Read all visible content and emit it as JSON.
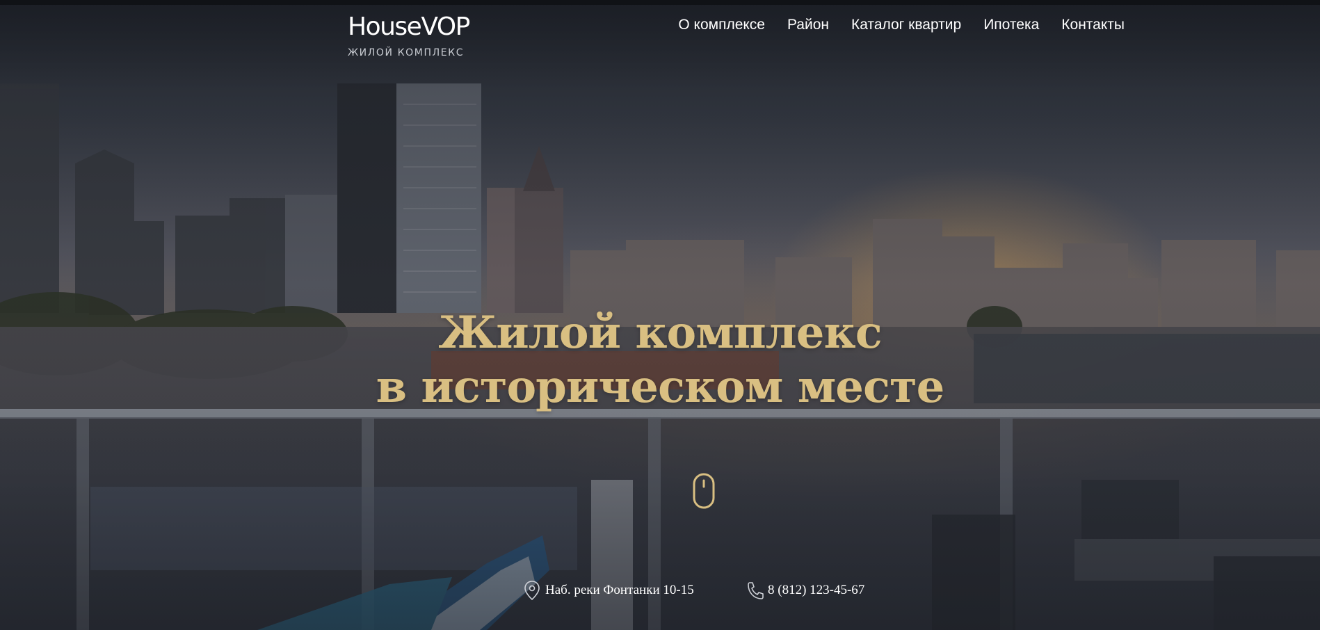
{
  "header": {
    "logo_title": "HouseVOP",
    "logo_subtitle": "ЖИЛОЙ КОМПЛЕКС",
    "nav": [
      {
        "label": "О комплексе"
      },
      {
        "label": "Район"
      },
      {
        "label": "Каталог квартир"
      },
      {
        "label": "Ипотека"
      },
      {
        "label": "Контакты"
      }
    ]
  },
  "hero": {
    "title_line1": "Жилой комплекс",
    "title_line2": "в историческом месте",
    "scroll_icon": "mouse-scroll-icon"
  },
  "contacts": {
    "address": "Наб. реки Фонтанки 10-15",
    "address_icon": "location-pin-icon",
    "phone": "8 (812) 123-45-67",
    "phone_icon": "phone-icon"
  },
  "colors": {
    "accent_gold": "#d9bf82",
    "text_white": "#ffffff",
    "background_dark": "#1f242c"
  }
}
